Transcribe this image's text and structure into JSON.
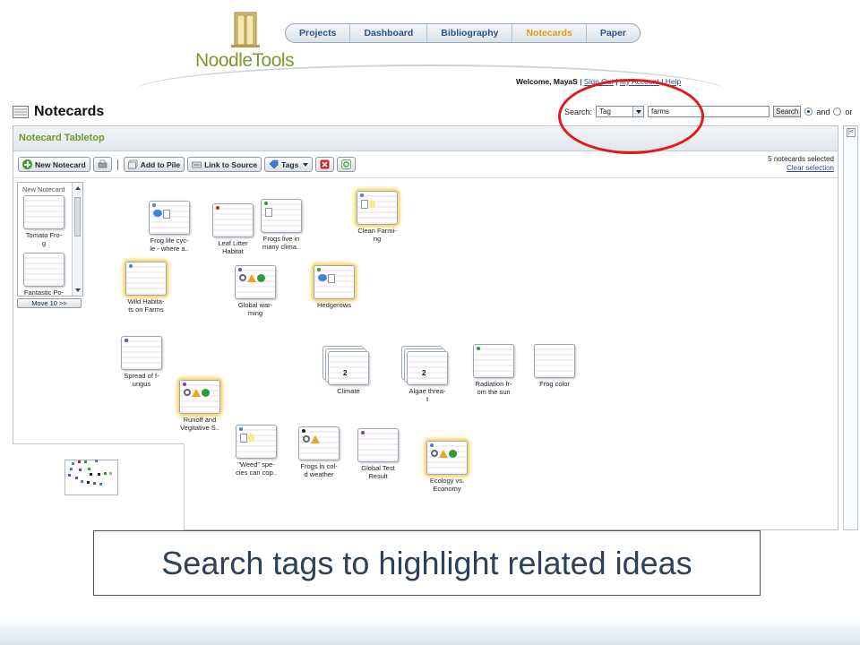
{
  "app": {
    "logo_text": "NoodleTools"
  },
  "nav": {
    "items": [
      {
        "label": "Projects",
        "active": false
      },
      {
        "label": "Dashboard",
        "active": false
      },
      {
        "label": "Bibliography",
        "active": false
      },
      {
        "label": "Notecards",
        "active": true
      },
      {
        "label": "Paper",
        "active": false
      }
    ]
  },
  "user_bar": {
    "welcome": "Welcome, MayaS",
    "sep": "|",
    "sign_out": "Sign Out",
    "my_account": "My Account",
    "help": "Help"
  },
  "page": {
    "title": "Notecards"
  },
  "search": {
    "label": "Search:",
    "field_select": "Tag",
    "query": "farms",
    "button": "Search",
    "and_label": "and",
    "or_label": "or",
    "mode_selected": "and"
  },
  "tabletop": {
    "title": "Notecard Tabletop",
    "toolbar": {
      "new_notecard": "New Notecard",
      "add_to_pile": "Add to Pile",
      "link_to_source": "Link to Source",
      "tags": "Tags",
      "separator": "|"
    },
    "selection": {
      "count_text": "5 notecards selected",
      "clear": "Clear selection"
    },
    "collapse": "|<"
  },
  "pile": {
    "title": "New Notecard",
    "cards": [
      {
        "label_line1": "Tomato Fro-",
        "label_line2": "g"
      },
      {
        "label_line1": "Fantastic Po-",
        "label_line2": ""
      }
    ],
    "move_button": "Move 10 >>"
  },
  "cards": [
    {
      "line1": "Frog life cyc-",
      "line2": "le - where a..",
      "highlight": false,
      "dot": "#4a7fd0",
      "icons": [
        "speech-icon",
        "doc-icon"
      ]
    },
    {
      "line1": "Leaf Litter",
      "line2": "Habitat",
      "highlight": false,
      "dot": "#d41c1c",
      "icons": []
    },
    {
      "line1": "Frogs live in",
      "line2": "many clima..",
      "highlight": false,
      "dot": "#2e9c37",
      "icons": [
        "doc-icon"
      ]
    },
    {
      "line1": "Clean Farmi-",
      "line2": "ng",
      "highlight": true,
      "dot": "#4a7fd0",
      "icons": [
        "doc-icon",
        "bulb-icon"
      ]
    },
    {
      "line1": "Wild Habita-",
      "line2": "ts on Farms",
      "highlight": true,
      "dot": "#4a7fd0",
      "icons": []
    },
    {
      "line1": "Global war-",
      "line2": "ming",
      "highlight": false,
      "dot": "#7b3fc4",
      "icons": [
        "magnifier-icon",
        "warning-icon",
        "check-icon"
      ]
    },
    {
      "line1": "Hedgerows",
      "line2": "",
      "highlight": true,
      "dot": "#2e9c37",
      "icons": [
        "speech-icon",
        "doc-icon"
      ]
    },
    {
      "line1": "Spread of f-",
      "line2": "ungus",
      "highlight": false,
      "dot": "#7b3fc4",
      "icons": []
    },
    {
      "line1": "Runoff and",
      "line2": "Vegitative S..",
      "highlight": true,
      "dot": "#7b3fc4",
      "icons": [
        "magnifier-icon",
        "warning-icon",
        "check-icon"
      ]
    },
    {
      "line1": "Climate",
      "line2": "",
      "highlight": false,
      "dot": "",
      "icons": [],
      "stack": "2"
    },
    {
      "line1": "Algae threa-",
      "line2": "t",
      "highlight": false,
      "dot": "",
      "icons": [],
      "stack": "2"
    },
    {
      "line1": "Radiation fr-",
      "line2": "om the sun",
      "highlight": false,
      "dot": "#2e9c37",
      "icons": []
    },
    {
      "line1": "Frog color",
      "line2": "",
      "highlight": false,
      "dot": "",
      "icons": []
    },
    {
      "line1": "\"Weed\" spe-",
      "line2": "cies can cop..",
      "highlight": false,
      "dot": "#4a7fd0",
      "icons": [
        "doc-icon",
        "bulb-icon"
      ]
    },
    {
      "line1": "Frogs in col-",
      "line2": "d weather",
      "highlight": false,
      "dot": "#222222",
      "icons": [
        "magnifier-icon",
        "warning-icon"
      ]
    },
    {
      "line1": "Global Test",
      "line2": "Result",
      "highlight": false,
      "dot": "#7b3fc4",
      "icons": []
    },
    {
      "line1": "Ecology vs.",
      "line2": "Economy",
      "highlight": true,
      "dot": "#4a7fd0",
      "icons": [
        "magnifier-icon",
        "warning-icon",
        "check-icon"
      ]
    }
  ],
  "caption": {
    "text": "Search tags to highlight related ideas"
  },
  "colors": {
    "nav_text": "#2b5586",
    "nav_active": "#e0a100",
    "tabletop_title": "#6f9a2e",
    "highlight_glow": "#f2cf52",
    "annotation_circle": "#e01b1b"
  }
}
